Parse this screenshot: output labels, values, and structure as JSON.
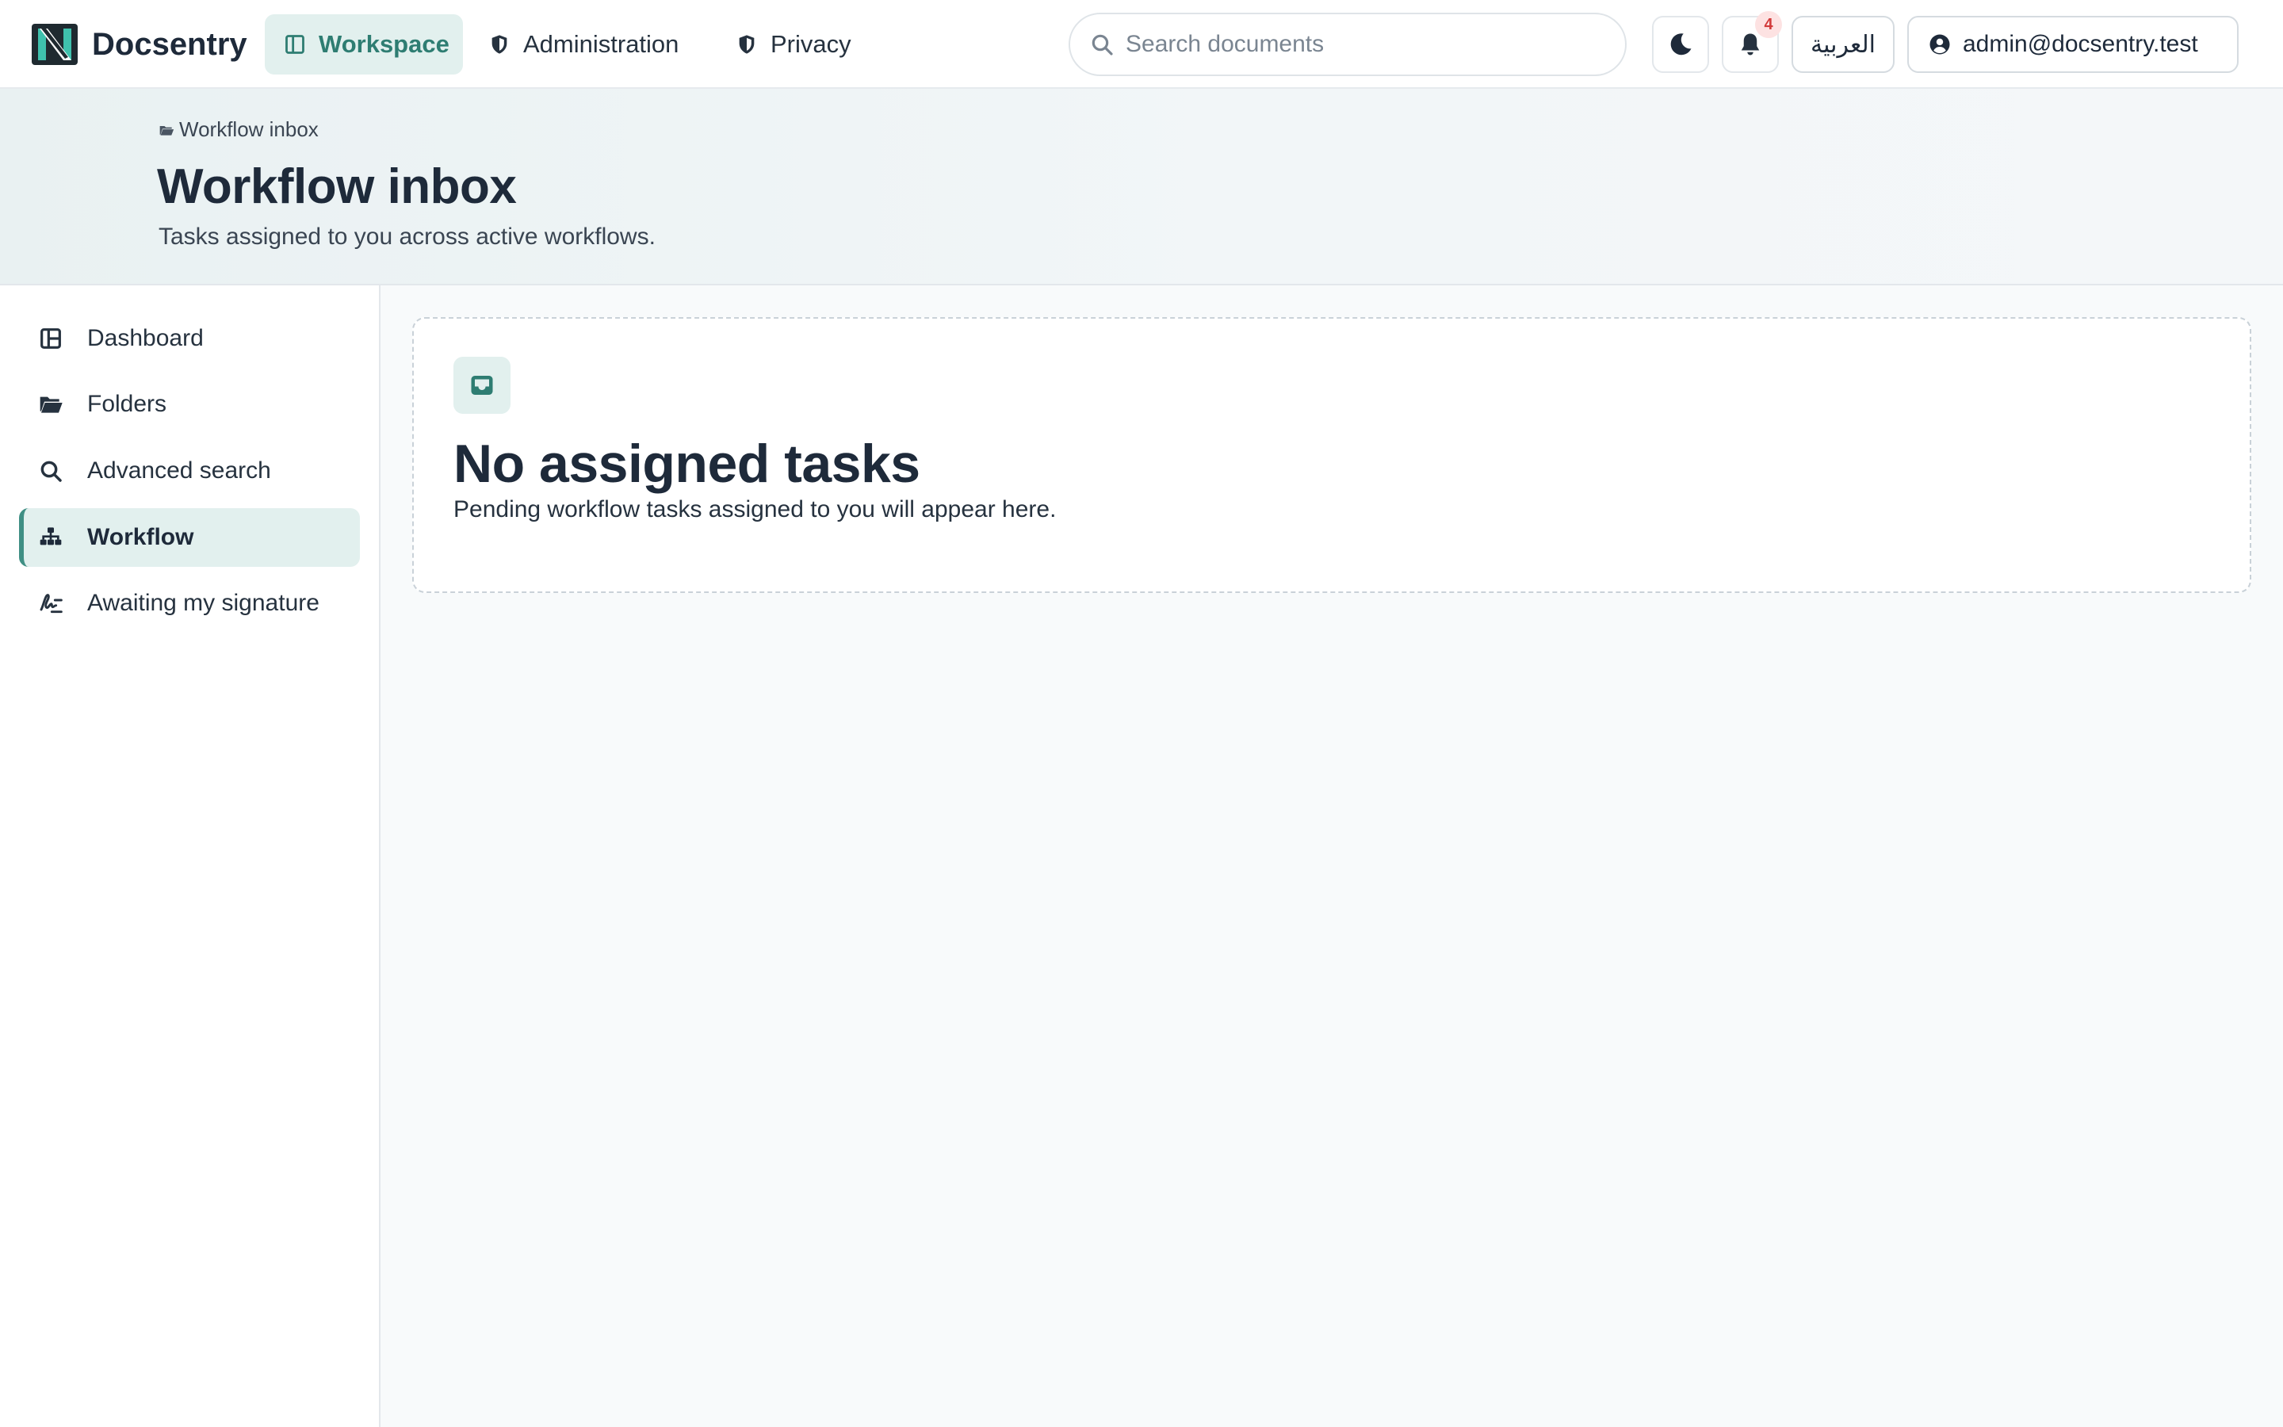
{
  "app": {
    "name": "Docsentry"
  },
  "nav": {
    "items": [
      {
        "label": "Workspace",
        "icon": "layout-icon",
        "active": true
      },
      {
        "label": "Administration",
        "icon": "shield-icon",
        "active": false
      },
      {
        "label": "Privacy",
        "icon": "shield-half-icon",
        "active": false
      }
    ]
  },
  "search": {
    "placeholder": "Search documents",
    "value": ""
  },
  "notifications": {
    "count": "4"
  },
  "language": {
    "label": "العربية"
  },
  "user": {
    "email": "admin@docsentry.test"
  },
  "header": {
    "breadcrumb": "Workflow inbox",
    "title": "Workflow inbox",
    "subtitle": "Tasks assigned to you across active workflows."
  },
  "sidebar": {
    "items": [
      {
        "label": "Dashboard",
        "icon": "dashboard-icon",
        "active": false
      },
      {
        "label": "Folders",
        "icon": "folder-open-icon",
        "active": false
      },
      {
        "label": "Advanced search",
        "icon": "search-icon",
        "active": false
      },
      {
        "label": "Workflow",
        "icon": "sitemap-icon",
        "active": true
      },
      {
        "label": "Awaiting my signature",
        "icon": "signature-icon",
        "active": false
      }
    ]
  },
  "empty_state": {
    "icon": "inbox-icon",
    "title": "No assigned tasks",
    "description": "Pending workflow tasks assigned to you will appear here."
  },
  "colors": {
    "accent": "#2e7d72",
    "accent_soft": "#e2f0ee",
    "text": "#1e2a3a",
    "badge_bg": "#fde2e2",
    "badge_text": "#d23b3b"
  }
}
